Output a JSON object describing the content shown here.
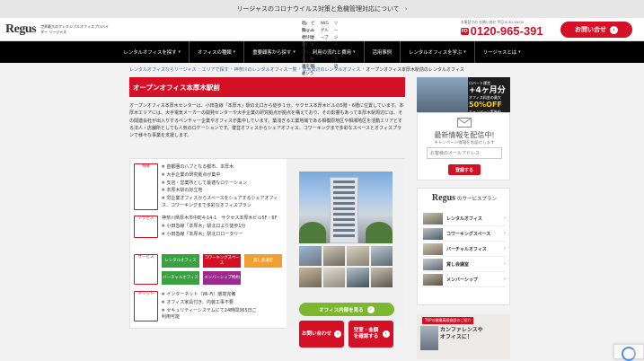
{
  "notice": {
    "text": "リージャスのコロナウイルス対策と危機管理対応について"
  },
  "header": {
    "logo": "Regus",
    "logo_sub": "世界最大のフレキシブルオフィスプロバイダー リージャス",
    "top_links_row1": [
      "My Regus で時間貸しオフィス・会議室をオンライン予約"
    ],
    "top_links_row2": [
      "ご契約の流れと必要書類",
      "ビルオーナー様",
      "IWG グループ",
      "リージャス英語"
    ],
    "phone_hours": "お電話での お問い合せ 平日 8:30-18:00",
    "phone_badge": "FD",
    "phone_number": "0120-965-391",
    "contact_label": "お問い合せ"
  },
  "nav": {
    "items": [
      "レンタルオフィスを探す",
      "オフィスの種類",
      "重要顧客から探す",
      "利用の流れと費用",
      "活用事例",
      "レンタルオフィスを学ぶ",
      "リージャスとは"
    ]
  },
  "breadcrumb": {
    "items": [
      "レンタルオフィスならリージャス",
      "エリアで探す",
      "神奈川のレンタルオフィス一覧",
      "厚木周辺のレンタルオフィス"
    ],
    "current": "オープンオフィス本厚木駅前のレンタルオフィス"
  },
  "title": "オープンオフィス本厚木駅前",
  "intro": "オープンオフィス本厚木センターは、小田急線「本厚木」駅の北口から徒歩１分。サクセス本厚木ビルの5階・6階に位置しています。本厚木エリアには、大手電気メーカーの開発センターや大手企業の研究拠点が拠点を構えており、その影響もあって本厚木駅周辺には、その関連会社が出入りするベンチャー企業やオフィスが集中しています。築浅ぎる工業地域である相模原地区や相湘地区を活動エリアとする法人・店舗所としても人気のロケーションです。復営オフィスからシェアオフィス、コワーキングまで多彩なスペースとオフィスプランで様々な事業を支援します。",
  "info": {
    "features_tag": "特徴",
    "features": [
      "首都圏の八ブとなる都市、本厚木",
      "大手企業の研究拠点が集中",
      "支店・営業所として最適なロケーション",
      "本厚木駅の好立地",
      "労企業オフィスからスペースをシュアするシェアオフィス、コワーキングまで多彩なオフィスプラン"
    ],
    "access_tag": "アクセス",
    "address": "神奈川県厚木市中町4-14-1　サクセス本厚木ビル5F・6F",
    "stations": [
      "小田急線「本厚木」駅北口より徒歩1分",
      "小田急線「本厚木」駅北口ロータリー"
    ],
    "service_tag": "サービス",
    "services": [
      {
        "label": "レンタルオフィス",
        "color": "green"
      },
      {
        "label": "コワーキングスペース",
        "color": "red"
      },
      {
        "label": "貸し会議室",
        "color": "orange"
      },
      {
        "label": "バーチャルオフィス",
        "color": "green"
      },
      {
        "label": "メンバーシップ特約",
        "color": "purple"
      }
    ],
    "merit_tag": "メリット",
    "merits": [
      "インターネット（Wi-Fi）環境完備",
      "オフィス家具付き、内装工事不要",
      "セキュリティーシステムにて24時間365日ご利用可能"
    ]
  },
  "photo_buttons": {
    "details": "オフィス内部を見る",
    "contact": "お問い合わせ",
    "availability": "空室・金額を確認する"
  },
  "sidebar": {
    "ad1_line1": "ロバート運営",
    "ad1_big": "+4ヶ月分",
    "ad1_mid": "オフィス料金の最大",
    "ad1_big2": "50%OFF",
    "ad1_small": "キャンペーン実施中",
    "news_title": "最新情報を配信中!",
    "news_sub": "キャンペーン情報をお届けします",
    "email_placeholder": "お客様のメールアドレス",
    "register_label": "登録する",
    "plan_logo": "Regus",
    "plan_title": "のサービスプラン",
    "plans": [
      "レンタルオフィス",
      "コワーキングスペース",
      "バーチャルオフィス",
      "貸し会議室",
      "メンバーシップ"
    ],
    "ad2_ribbon": "TKPの開業高級施設のご紹介",
    "ad2_text1": "カンファレンスや",
    "ad2_text2": "オフィスに！"
  }
}
